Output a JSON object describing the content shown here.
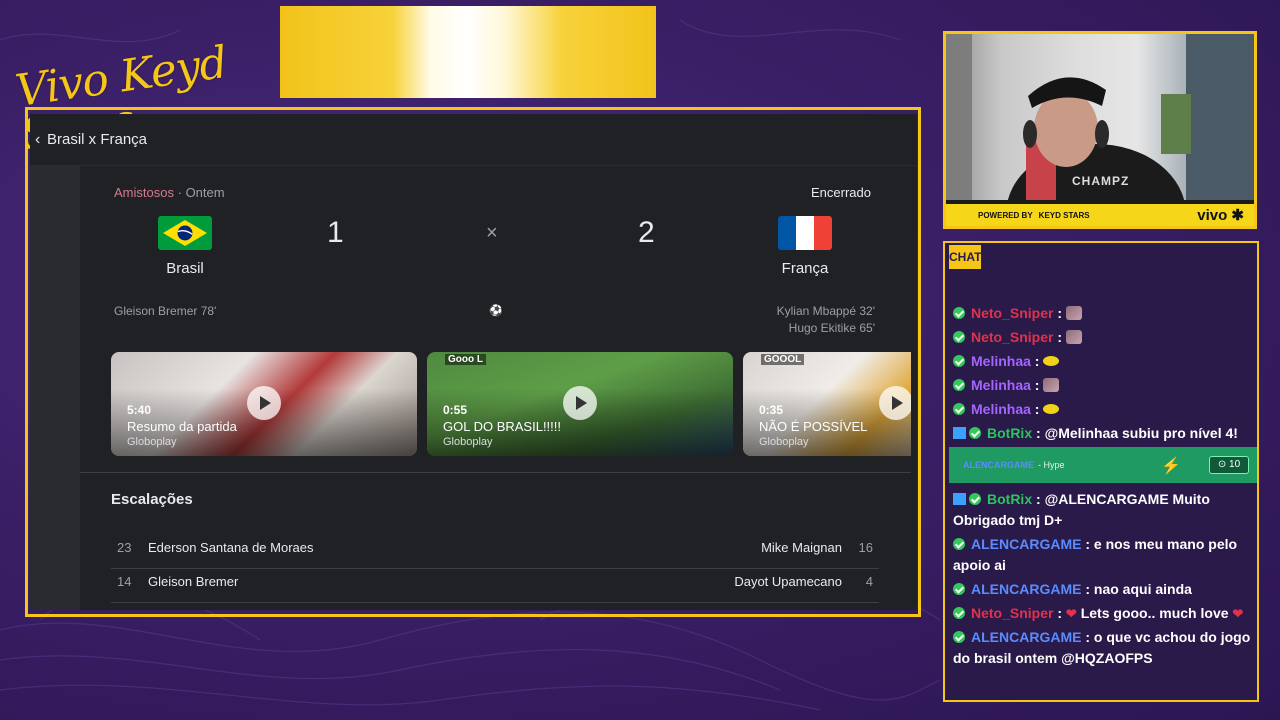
{
  "brand": {
    "script_text": "Vivo Keyd Stars"
  },
  "browser": {
    "title": "Brasil x França",
    "match": {
      "competition": "Amistosos",
      "date_sep": "·",
      "date": "Ontem",
      "status": "Encerrado",
      "home": {
        "name": "Brasil",
        "score": "1",
        "scorers": [
          "Gleison Bremer 78'"
        ]
      },
      "away": {
        "name": "França",
        "score": "2",
        "scorers": [
          "Kylian Mbappé 32'",
          "Hugo Ekitike 65'"
        ]
      },
      "separator": "×",
      "ball_icon": "soccer-ball-icon"
    },
    "videos": [
      {
        "duration": "5:40",
        "title": "Resumo da partida",
        "source": "Globoplay",
        "tag": ""
      },
      {
        "duration": "0:55",
        "title": "GOL DO BRASIL!!!!!",
        "source": "Globoplay",
        "tag": "Gooo L"
      },
      {
        "duration": "0:35",
        "title": "NÃO É POSSÍVEL",
        "source": "Globoplay",
        "tag": "GOOOL"
      }
    ],
    "lineups": {
      "title": "Escalações",
      "rows": [
        {
          "home_num": "23",
          "home_player": "Ederson Santana de Moraes",
          "away_player": "Mike Maignan",
          "away_num": "16"
        },
        {
          "home_num": "14",
          "home_player": "Gleison Bremer",
          "away_player": "Dayot Upamecano",
          "away_num": "4"
        }
      ]
    }
  },
  "webcam": {
    "powered_by": "POWERED BY",
    "keyd": "KEYD STARS",
    "vivo": "vivo",
    "shirt_text": "CHAMPZ"
  },
  "chat": {
    "label": "CHAT",
    "messages": [
      {
        "user": "Neto_Sniper",
        "color": "u-red",
        "text": "",
        "emote": "e1"
      },
      {
        "user": "Neto_Sniper",
        "color": "u-red",
        "text": "",
        "emote": "e1"
      },
      {
        "user": "Melinhaa",
        "color": "u-purple",
        "text": "",
        "emote": "e2"
      },
      {
        "user": "Melinhaa",
        "color": "u-purple",
        "text": "",
        "emote": "e1"
      },
      {
        "user": "Melinhaa",
        "color": "u-purple",
        "text": "",
        "emote": "e2"
      },
      {
        "user": "BotRix",
        "color": "u-green",
        "text": "@Melinhaa subiu pro nível 4!",
        "bot": true
      }
    ],
    "hype": {
      "user": "ALENCARGAME",
      "label": "- Hype",
      "count": "10"
    },
    "messages2": [
      {
        "user": "BotRix",
        "color": "u-green",
        "text": "@ALENCARGAME Muito Obrigado tmj D+",
        "bot": true
      },
      {
        "user": "ALENCARGAME",
        "color": "u-blue",
        "text": "e nos meu mano pelo apoio ai"
      },
      {
        "user": "ALENCARGAME",
        "color": "u-blue",
        "text": "nao aqui ainda"
      },
      {
        "user": "Neto_Sniper",
        "color": "u-red",
        "text": "Lets gooo.. much love",
        "hearts": true
      },
      {
        "user": "ALENCARGAME",
        "color": "u-blue",
        "text": "o que vc achou do jogo do brasil ontem @HQZAOFPS"
      }
    ]
  }
}
